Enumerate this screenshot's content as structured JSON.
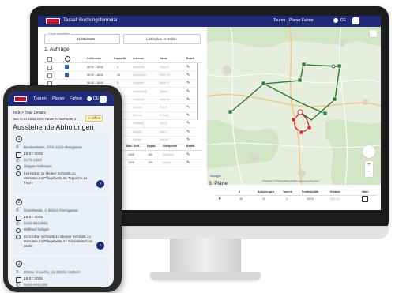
{
  "desktop": {
    "nav": {
      "brand": "Tessell  Buchungsformular",
      "menu": [
        "Touren",
        "Planer",
        "Fahrer"
      ],
      "user": "DE"
    },
    "date_label": "Datum auswählen",
    "date_value": "21/06/2025",
    "generate_button": "Lieferplan erstellen",
    "section_orders": "1. Aufträge",
    "orders_columns": [
      "",
      "",
      "Zeitfenster",
      "Kapazität",
      "Adresse",
      "Name",
      "Bearb."
    ],
    "orders_rows": [
      {
        "icon": true,
        "time": "08:00 - 18:00",
        "cap": "1",
        "addr": "Musterstr.",
        "name": "Hans K."
      },
      {
        "icon": true,
        "time": "08:00 - 18:00",
        "cap": "10",
        "addr": "Bahnhofstr.",
        "name": "Peter M."
      },
      {
        "icon": false,
        "time": "08:00 - 18:00",
        "cap": "3",
        "addr": "Hauptstr.",
        "name": "Anna S."
      },
      {
        "icon": false,
        "time": "09:00 - 17:00",
        "cap": "3",
        "addr": "Gartenweg",
        "name": "Maria L."
      },
      {
        "icon": false,
        "time": "09:00 - 17:00",
        "cap": "4",
        "addr": "Lindenstr.",
        "name": "Klaus B."
      },
      {
        "icon": false,
        "time": "08:00 - 18:00",
        "cap": "20",
        "addr": "Schulstr.",
        "name": "Eva R."
      },
      {
        "icon": false,
        "time": "08:00 - 18:00",
        "cap": "1",
        "addr": "Am Hof",
        "name": "F. Berg"
      },
      {
        "icon": false,
        "time": "08:00 - 18:00",
        "cap": "15",
        "addr": "Feldweg",
        "name": "Jan O."
      },
      {
        "icon": false,
        "time": "08:00 - 18:00",
        "cap": "1",
        "addr": "Ringstr.",
        "name": "Uwe T."
      },
      {
        "icon": false,
        "time": "08:00 - 18:00",
        "cap": "1",
        "addr": "Dorfstr.",
        "name": "Lisa W."
      }
    ],
    "drivers_columns": [
      "",
      "Arbeitszeit",
      "Max. Entf.",
      "Kapaz.",
      "Startpunkt",
      "Bearb."
    ],
    "drivers_rows": [
      {
        "time": "08:00 - 17:00",
        "dist": "1000",
        "cap": "100",
        "start": "Bahnhof"
      },
      {
        "time": "08:00 - 17:00",
        "dist": "1000",
        "cap": "100",
        "start": "Depot"
      }
    ],
    "section_plans": "3. Pläne",
    "plans_columns": [
      "",
      "#",
      "Abholungen",
      "Touren",
      "Profitabilität",
      "Distanz",
      "Wahl"
    ],
    "plans_rows": [
      {
        "num": "46",
        "pickups": "10",
        "tours": "2",
        "profit": "100%",
        "dist": "288 km"
      }
    ],
    "map_attribution": "Kartendaten ©2025 GeoBasis-DE/BKG  Nutzungsbedingungen"
  },
  "phone": {
    "nav": {
      "menu": [
        "Touren",
        "Planer",
        "Fahrer"
      ],
      "user": "DE"
    },
    "breadcrumb": "Tour  >  Tour Details",
    "tour_line": "Tour ID #1 16.08.2025  Fahrer in TaxiFahrer 3",
    "warning": "Offen",
    "title": "Ausstehende Abholungen",
    "cards": [
      {
        "num": "1",
        "address": "Beckenheim, 07.8 1223 Ifrengasse",
        "date": "16.07.2025",
        "phone": "0179 1983",
        "name": "Jürgen Hofmann",
        "items": "1x Hocker,1x kleiner Schrank,1x Matratze,1x Pflegebette,3x Teppiche,1x Tisch"
      },
      {
        "num": "2",
        "address": "Grantheide, 1 30221 Fierngasse",
        "date": "16.07.2025",
        "phone": "0163 8812981",
        "name": "Wilfried Seliger",
        "items": "2x Großer Schrank,1x Kleiner Schrank,1x Matratze,1x Pflegebette,1x Schreibtisch,4x Stuhl"
      },
      {
        "num": "3",
        "address": "Zülow, 3 Luche, 11 68231 Haltern",
        "date": "16.07.2025",
        "phone": "0163 4411281",
        "name": "",
        "items": ""
      }
    ]
  },
  "colors": {
    "nav": "#1f2a7a",
    "brand_red": "#c8102e",
    "route_green": "#2e7d32",
    "route_red": "#d32f2f"
  }
}
